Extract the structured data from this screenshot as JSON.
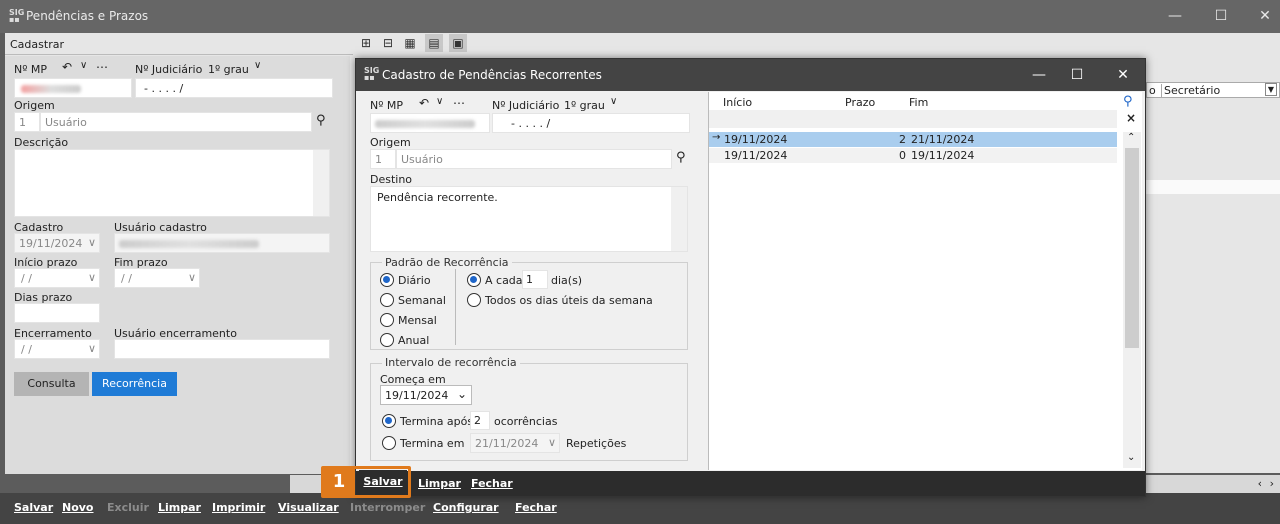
{
  "app": {
    "title": "Pendências e Prazos",
    "window_controls": {
      "minimize": "—",
      "maximize": "☐",
      "close": "✕"
    }
  },
  "left_form": {
    "header": "Cadastrar",
    "nmp_label": "Nº MP",
    "njud_label": "Nº Judiciário",
    "grau": "1º grau",
    "njud_value": "- .    . . .   /",
    "origem_label": "Origem",
    "origem_code": "1",
    "origem_value": "Usuário",
    "descricao_label": "Descrição",
    "cadastro_label": "Cadastro",
    "cadastro_value": "19/11/2024",
    "usuario_cadastro_label": "Usuário cadastro",
    "inicio_prazo_label": "Início prazo",
    "inicio_prazo_value": " / /",
    "fim_prazo_label": "Fim prazo",
    "fim_prazo_value": " / /",
    "dias_prazo_label": "Dias prazo",
    "encerramento_label": "Encerramento",
    "encerramento_value": " / /",
    "usuario_encerramento_label": "Usuário encerramento",
    "consulta_button": "Consulta",
    "recorrencia_button": "Recorrência"
  },
  "right_grid": {
    "col_a": "o",
    "col_b": "Secretário"
  },
  "dialog": {
    "title": "Cadastro de Pendências Recorrentes",
    "nmp_label": "Nº MP",
    "njud_label": "Nº Judiciário",
    "grau": "1º grau",
    "njud_value": "- .    . . .   /",
    "origem_label": "Origem",
    "origem_code": "1",
    "origem_value": "Usuário",
    "destino_label": "Destino",
    "destino_value": "Pendência recorrente.",
    "padrao_label": "Padrão de Recorrência",
    "opt_diario": "Diário",
    "opt_semanal": "Semanal",
    "opt_mensal": "Mensal",
    "opt_anual": "Anual",
    "a_cada_label": "A cada",
    "a_cada_value": "1",
    "dias_label": "dia(s)",
    "uteis_label": "Todos os dias úteis da semana",
    "intervalo_label": "Intervalo de recorrência",
    "comeca_label": "Começa em",
    "comeca_value": "19/11/2024",
    "termina_apos_label": "Termina após",
    "termina_apos_value": "2",
    "ocorrencias_label": "ocorrências",
    "termina_em_label": "Termina em",
    "termina_em_value": "21/11/2024",
    "repeticoes_label": "Repetições",
    "grid": {
      "headers": [
        "Início",
        "Prazo",
        "Fim"
      ],
      "rows": [
        {
          "inicio": "19/11/2024",
          "prazo": "2",
          "fim": "21/11/2024"
        },
        {
          "inicio": "19/11/2024",
          "prazo": "0",
          "fim": "19/11/2024"
        }
      ]
    },
    "footer": {
      "salvar": "Salvar",
      "limpar": "Limpar",
      "fechar": "Fechar"
    },
    "badge": "1"
  },
  "bottom_bar": {
    "salvar": "Salvar",
    "novo": "Novo",
    "excluir": "Excluir",
    "limpar": "Limpar",
    "imprimir": "Imprimir",
    "visualizar": "Visualizar",
    "interromper": "Interromper",
    "configurar": "Configurar",
    "fechar": "Fechar"
  },
  "colors": {
    "accent": "#1f7bd6",
    "highlight": "#e07a1c",
    "selected_row": "#a9cdee"
  }
}
